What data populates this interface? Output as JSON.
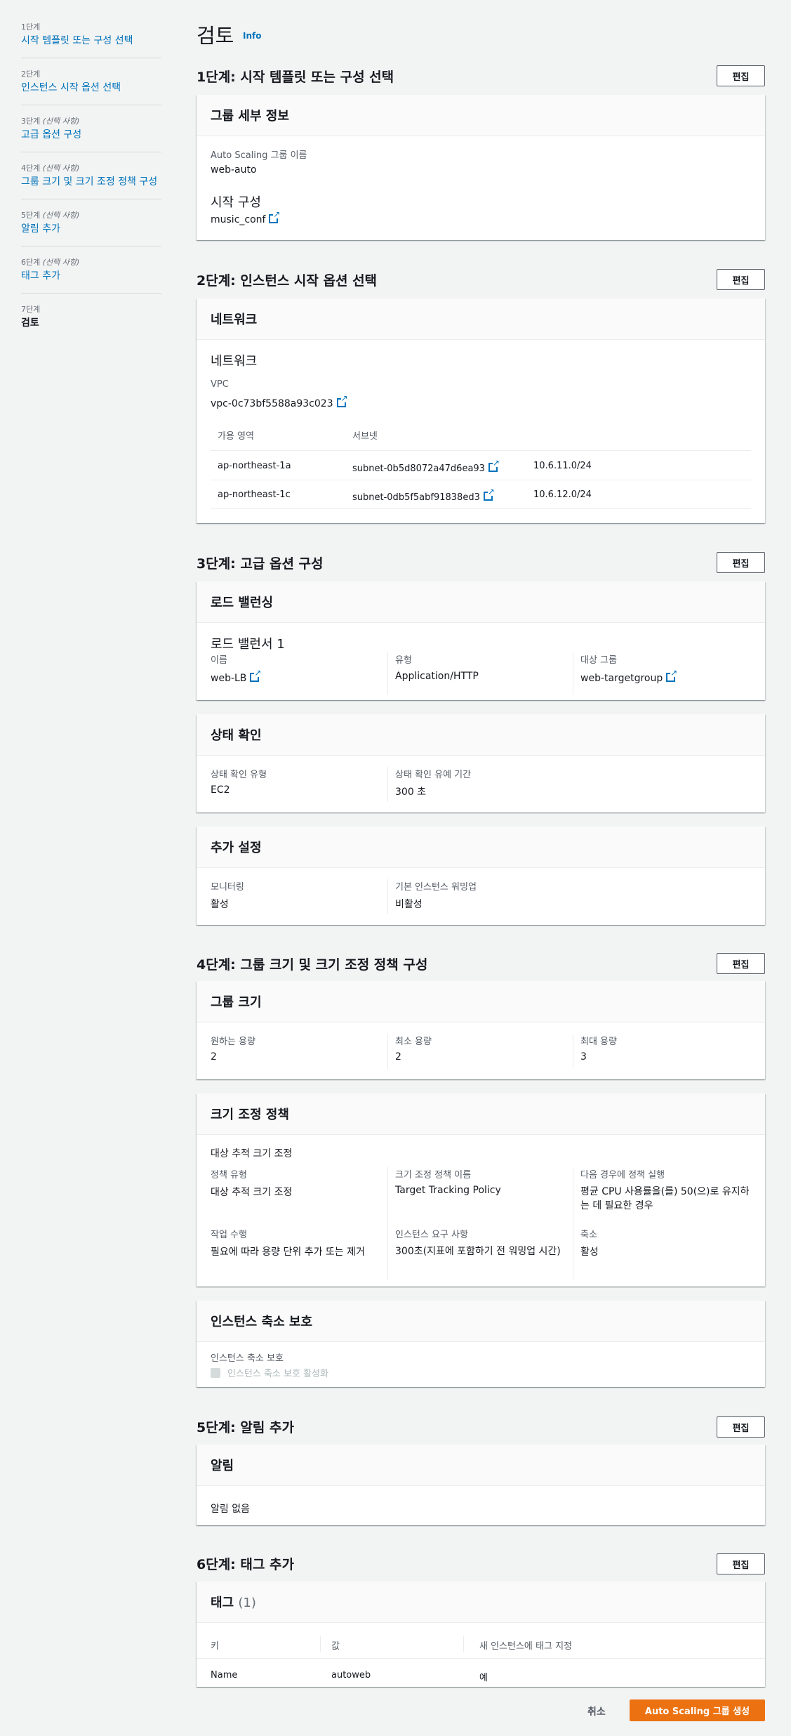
{
  "sidebar": {
    "steps": [
      {
        "num": "1단계",
        "optional": "",
        "label": "시작 템플릿 또는 구성 선택"
      },
      {
        "num": "2단계",
        "optional": "",
        "label": "인스턴스 시작 옵션 선택"
      },
      {
        "num": "3단계",
        "optional": "(선택 사항)",
        "label": "고급 옵션 구성"
      },
      {
        "num": "4단계",
        "optional": "(선택 사항)",
        "label": "그룹 크기 및 크기 조정 정책 구성"
      },
      {
        "num": "5단계",
        "optional": "(선택 사항)",
        "label": "알림 추가"
      },
      {
        "num": "6단계",
        "optional": "(선택 사항)",
        "label": "태그 추가"
      },
      {
        "num": "7단계",
        "optional": "",
        "label": "검토"
      }
    ]
  },
  "page": {
    "title": "검토",
    "info": "Info",
    "edit_label": "편집"
  },
  "step1": {
    "title": "1단계: 시작 템플릿 또는 구성 선택",
    "card_title": "그룹 세부 정보",
    "asg_name_label": "Auto Scaling 그룹 이름",
    "asg_name": "web-auto",
    "launch_config_heading": "시작 구성",
    "launch_config": "music_conf"
  },
  "step2": {
    "title": "2단계: 인스턴스 시작 옵션 선택",
    "card_title": "네트워크",
    "network_heading": "네트워크",
    "vpc_label": "VPC",
    "vpc": "vpc-0c73bf5588a93c023",
    "az_header": "가용 영역",
    "subnet_header": "서브넷",
    "rows": [
      {
        "az": "ap-northeast-1a",
        "subnet": "subnet-0b5d8072a47d6ea93",
        "cidr": "10.6.11.0/24"
      },
      {
        "az": "ap-northeast-1c",
        "subnet": "subnet-0db5f5abf91838ed3",
        "cidr": "10.6.12.0/24"
      }
    ]
  },
  "step3": {
    "title": "3단계: 고급 옵션 구성",
    "lb_card_title": "로드 밸런싱",
    "lb_heading": "로드 밸런서 1",
    "lb_name_label": "이름",
    "lb_name": "web-LB",
    "lb_type_label": "유형",
    "lb_type": "Application/HTTP",
    "lb_tg_label": "대상 그룹",
    "lb_tg": "web-targetgroup",
    "hc_card_title": "상태 확인",
    "hc_type_label": "상태 확인 유형",
    "hc_type": "EC2",
    "hc_grace_label": "상태 확인 유예 기간",
    "hc_grace": "300 초",
    "extra_card_title": "추가 설정",
    "monitoring_label": "모니터링",
    "monitoring": "활성",
    "warmup_label": "기본 인스턴스 워밍업",
    "warmup": "비활성"
  },
  "step4": {
    "title": "4단계: 그룹 크기 및 크기 조정 정책 구성",
    "size_card_title": "그룹 크기",
    "desired_label": "원하는 용량",
    "desired": "2",
    "min_label": "최소 용량",
    "min": "2",
    "max_label": "최대 용량",
    "max": "3",
    "policy_card_title": "크기 조정 정책",
    "policy_heading": "대상 추적 크기 조정",
    "policy_type_label": "정책 유형",
    "policy_type": "대상 추적 크기 조정",
    "policy_name_label": "크기 조정 정책 이름",
    "policy_name": "Target Tracking Policy",
    "execute_label": "다음 경우에 정책 실행",
    "execute": "평균 CPU 사용률을(를) 50(으)로 유지하는 데 필요한 경우",
    "action_label": "작업 수행",
    "action": "필요에 따라 용량 단위 추가 또는 제거",
    "requirement_label": "인스턴스 요구 사항",
    "requirement": "300초(지표에 포함하기 전 워밍업 시간)",
    "scalein_label": "축소",
    "scalein": "활성",
    "protect_card_title": "인스턴스 축소 보호",
    "protect_label": "인스턴스 축소 보호",
    "protect_checkbox": "인스턴스 축소 보호 활성화"
  },
  "step5": {
    "title": "5단계: 알림 추가",
    "card_title": "알림",
    "empty": "알림 없음"
  },
  "step6": {
    "title": "6단계: 태그 추가",
    "card_title": "태그",
    "card_count": "(1)",
    "key_header": "키",
    "value_header": "값",
    "propagate_header": "새 인스턴스에 태그 지정",
    "rows": [
      {
        "key": "Name",
        "value": "autoweb",
        "propagate": "예"
      }
    ]
  },
  "footer": {
    "cancel": "취소",
    "create": "Auto Scaling 그룹 생성"
  },
  "colors": {
    "link": "#0073bb",
    "primary": "#ec7211",
    "background": "#f2f3f3"
  }
}
